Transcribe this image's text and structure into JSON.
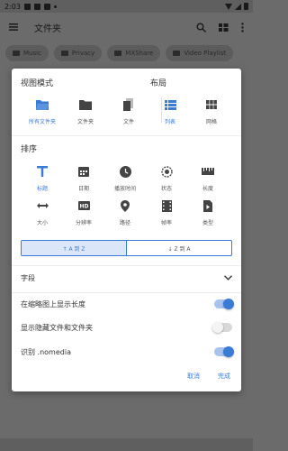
{
  "status": {
    "time": "2:03"
  },
  "appbar": {
    "title": "文件夹"
  },
  "chips": [
    "Music",
    "Privacy",
    "MXShare",
    "Video Playlist"
  ],
  "dialog": {
    "view_mode": {
      "title": "视图模式",
      "items": [
        {
          "label": "所有文件夹",
          "icon": "folder-open-icon",
          "active": true
        },
        {
          "label": "文件夹",
          "icon": "folder-icon",
          "active": false
        },
        {
          "label": "文件",
          "icon": "file-icon",
          "active": false
        }
      ]
    },
    "layout": {
      "title": "布局",
      "items": [
        {
          "label": "列表",
          "icon": "list-icon",
          "active": true
        },
        {
          "label": "网格",
          "icon": "grid-icon",
          "active": false
        }
      ]
    },
    "sort": {
      "title": "排序",
      "items": [
        {
          "label": "标题",
          "icon": "title-icon",
          "active": true
        },
        {
          "label": "日期",
          "icon": "calendar-icon",
          "active": false
        },
        {
          "label": "播放时间",
          "icon": "clock-icon",
          "active": false
        },
        {
          "label": "状态",
          "icon": "status-icon",
          "active": false
        },
        {
          "label": "长度",
          "icon": "ruler-icon",
          "active": false
        },
        {
          "label": "大小",
          "icon": "size-icon",
          "active": false
        },
        {
          "label": "分辨率",
          "icon": "hd-icon",
          "active": false
        },
        {
          "label": "路径",
          "icon": "location-icon",
          "active": false
        },
        {
          "label": "帧率",
          "icon": "film-icon",
          "active": false
        },
        {
          "label": "类型",
          "icon": "file-type-icon",
          "active": false
        }
      ],
      "asc_label": "↑ A 到 Z",
      "desc_label": "↓ Z 到 A"
    },
    "fields_label": "字段",
    "options": [
      {
        "label": "在缩略图上显示长度",
        "on": true
      },
      {
        "label": "显示隐藏文件和文件夹",
        "on": false
      },
      {
        "label": "识别 .nomedia",
        "on": true
      }
    ],
    "cancel_label": "取消",
    "done_label": "完成"
  },
  "colors": {
    "accent": "#3a7bd5",
    "dark_icon": "#444444"
  }
}
